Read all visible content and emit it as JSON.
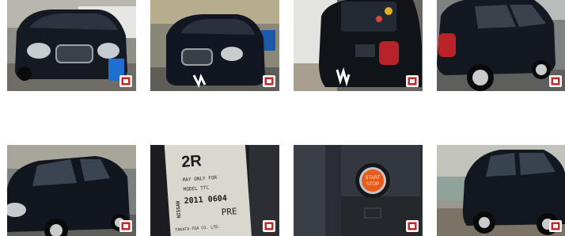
{
  "gallery": {
    "photos": [
      {
        "name": "front-view-parked",
        "badge_icon": "gallery-badge-icon"
      },
      {
        "name": "front-view-street",
        "badge_icon": "gallery-badge-icon"
      },
      {
        "name": "rear-hatch-view",
        "badge_icon": "gallery-badge-icon"
      },
      {
        "name": "rear-side-view",
        "badge_icon": "gallery-badge-icon"
      },
      {
        "name": "front-side-view",
        "badge_icon": "gallery-badge-icon"
      },
      {
        "name": "seatbelt-label",
        "badge_icon": "gallery-badge-icon"
      },
      {
        "name": "push-start-button",
        "badge_icon": "gallery-badge-icon"
      },
      {
        "name": "side-profile-view",
        "badge_icon": "gallery-badge-icon"
      }
    ],
    "seatbelt_label": {
      "code": "2R",
      "brand": "NISSAN",
      "line1": "MAY ONLY FOR",
      "line2": "MODEL TTC",
      "date": "2011 0604",
      "stamp": "PRE",
      "maker": "TAKATA-TOA CO. LTD."
    },
    "start_button": {
      "line1": "START",
      "line2": "STOP"
    }
  }
}
